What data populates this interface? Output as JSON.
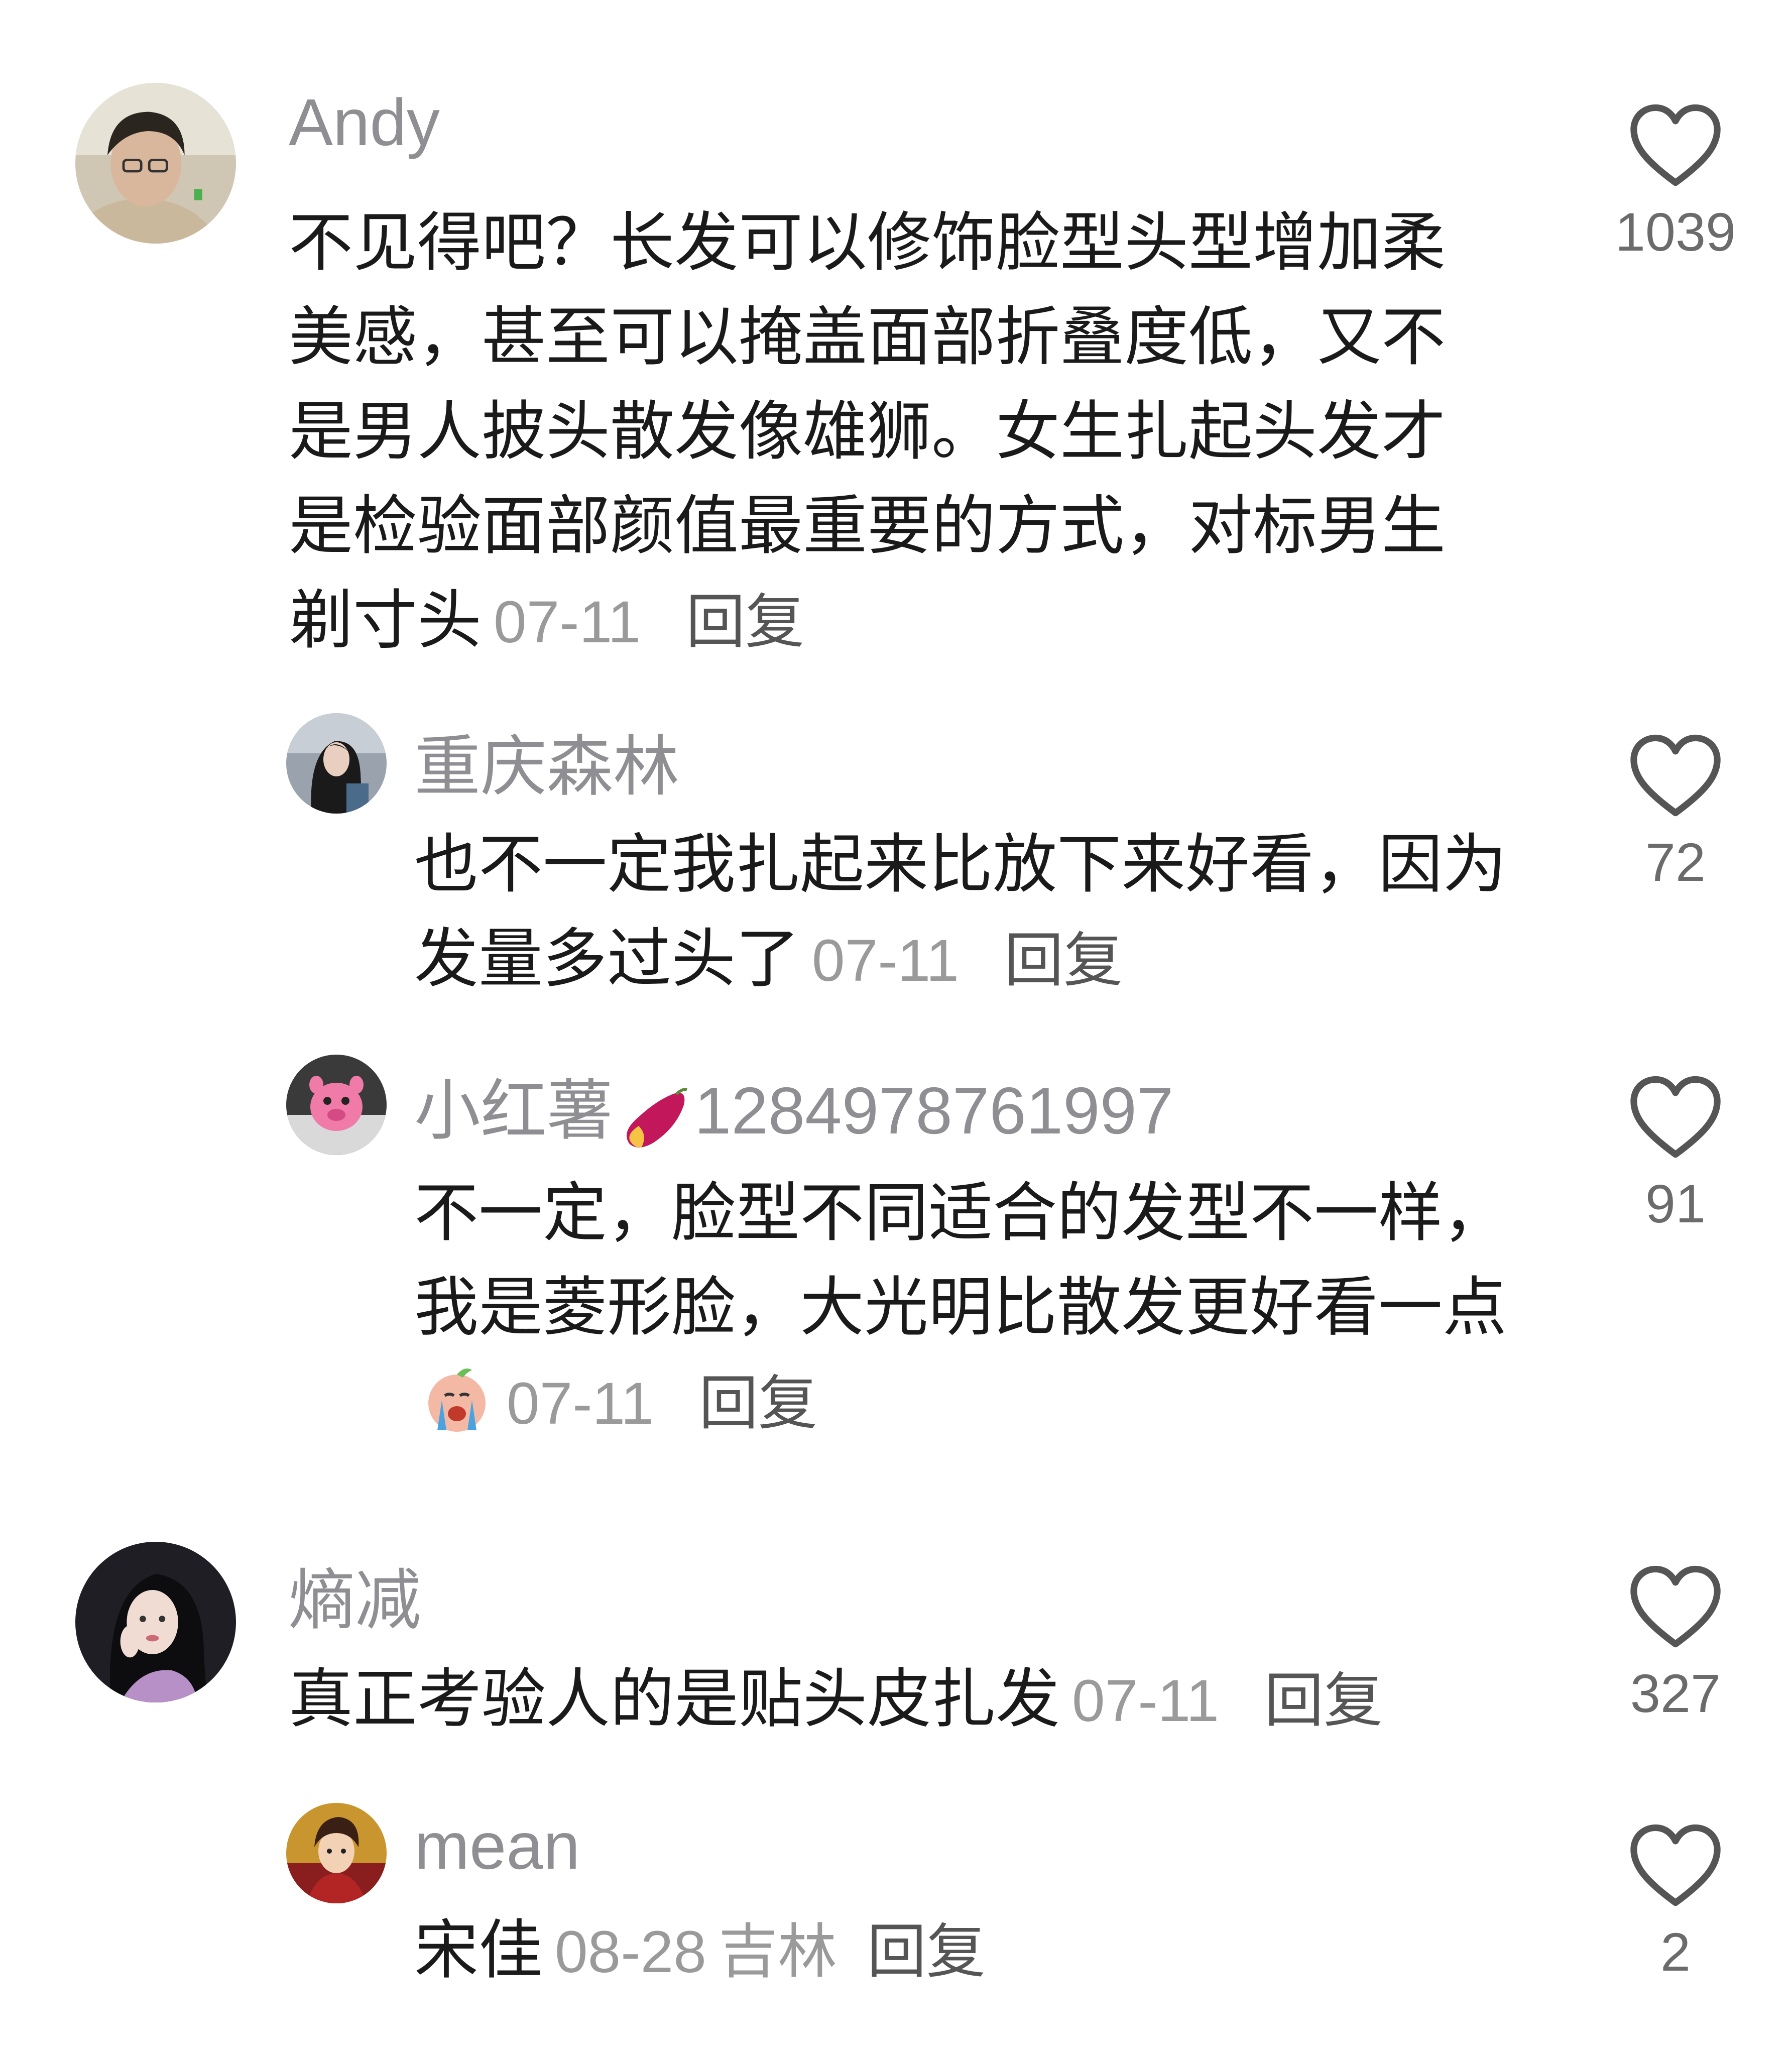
{
  "comments": [
    {
      "username": "Andy",
      "text": "不见得吧？长发可以修饰脸型头型增加柔美感，甚至可以掩盖面部折叠度低，又不是男人披头散发像雄狮。女生扎起头发才是检验面部颜值最重要的方式，对标男生剃寸头",
      "date": "07-11",
      "reply_label": "回复",
      "likes": "1039",
      "avatar_icon": "avatar-man-glasses"
    },
    {
      "username": "重庆森林",
      "text": "也不一定我扎起来比放下来好看，因为发量多过头了",
      "date": "07-11",
      "reply_label": "回复",
      "likes": "72",
      "avatar_icon": "avatar-woman-dark-hair"
    },
    {
      "username_prefix": "小红薯",
      "username_suffix": "1284978761997",
      "username_icon": "sweet-potato-icon",
      "text": "不一定，脸型不同适合的发型不一样，我是菱形脸，大光明比散发更好看一点",
      "text_emoji": "crying-face-emoji",
      "date": "07-11",
      "reply_label": "回复",
      "likes": "91",
      "avatar_icon": "avatar-pink-pig"
    },
    {
      "username": "熵减",
      "text": "真正考验人的是贴头皮扎发",
      "date": "07-11",
      "reply_label": "回复",
      "likes": "327",
      "avatar_icon": "avatar-woman-portrait"
    },
    {
      "username": "mean",
      "text": "宋佳",
      "date": "08-28",
      "region": "吉林",
      "reply_label": "回复",
      "likes": "2",
      "avatar_icon": "avatar-anime-character"
    }
  ],
  "colors": {
    "username": "#8e8e93",
    "text": "#1a1a1a",
    "meta": "#9a9a9a",
    "heart_outline": "#555555"
  }
}
